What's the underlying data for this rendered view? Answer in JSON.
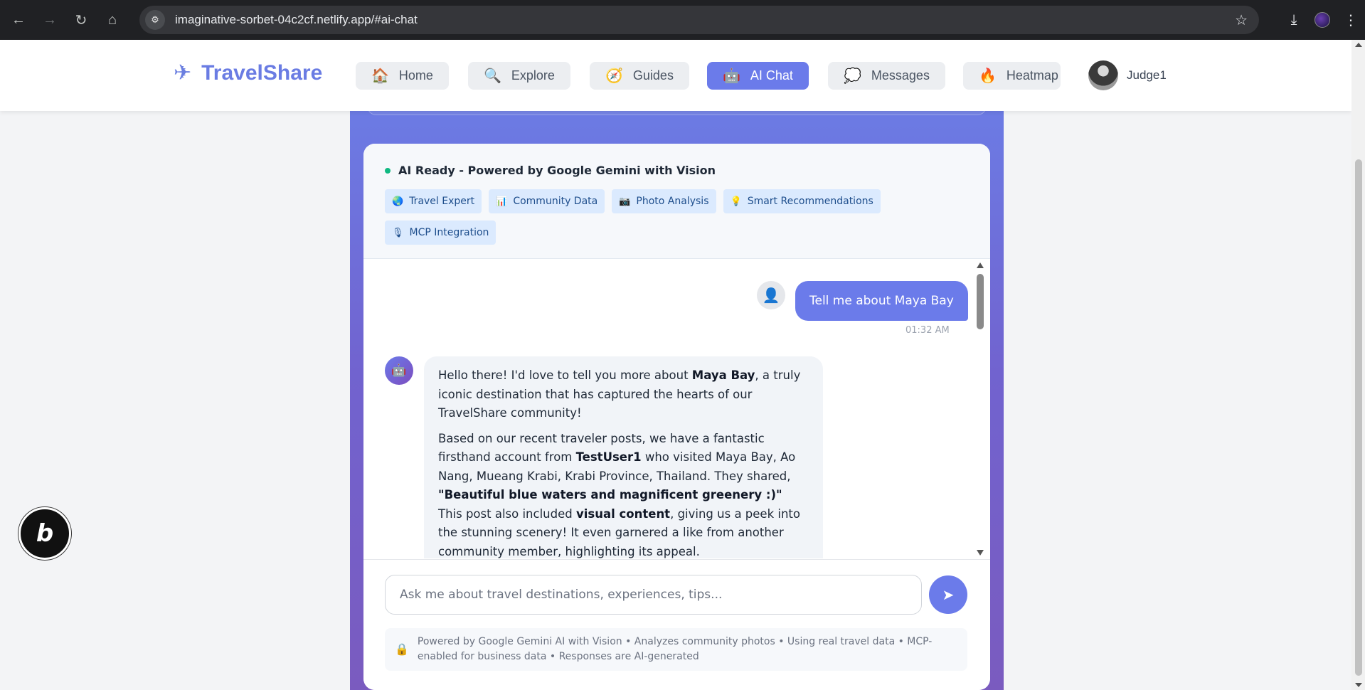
{
  "browser": {
    "url": "imaginative-sorbet-04c2cf.netlify.app/#ai-chat"
  },
  "header": {
    "brand": "TravelShare",
    "tabs": [
      {
        "label": "Home",
        "icon": "house-icon",
        "glyph": "🏠"
      },
      {
        "label": "Explore",
        "icon": "magnifier-icon",
        "glyph": "🔍"
      },
      {
        "label": "Guides",
        "icon": "compass-icon",
        "glyph": "🧭"
      },
      {
        "label": "AI Chat",
        "icon": "robot-icon",
        "glyph": "🤖"
      },
      {
        "label": "Messages",
        "icon": "speech-bubble-icon",
        "glyph": "💭"
      },
      {
        "label": "Heatmap",
        "icon": "fire-icon",
        "glyph": "🔥"
      }
    ],
    "active_tab": "AI Chat",
    "user_name": "Judge1"
  },
  "chat": {
    "status": "AI Ready - Powered by Google Gemini with Vision",
    "status_color": "#10b981",
    "chips": [
      {
        "label": "Travel Expert",
        "glyph": "🌏"
      },
      {
        "label": "Community Data",
        "glyph": "📊"
      },
      {
        "label": "Photo Analysis",
        "glyph": "📷"
      },
      {
        "label": "Smart Recommendations",
        "glyph": "💡"
      },
      {
        "label": "MCP Integration",
        "glyph": "🎙"
      }
    ],
    "user_message": {
      "text": "Tell me about Maya Bay",
      "time": "01:32 AM"
    },
    "bot_message": {
      "p1_a": "Hello there! I'd love to tell you more about ",
      "p1_b": "Maya Bay",
      "p1_c": ", a truly iconic destination that has captured the hearts of our TravelShare community!",
      "p2_a": "Based on our recent traveler posts, we have a fantastic firsthand account from ",
      "p2_b": "TestUser1",
      "p2_c": " who visited Maya Bay, Ao Nang, Mueang Krabi, Krabi Province, Thailand. They shared, ",
      "p2_d": "\"Beautiful blue waters and magnificent greenery :)\"",
      "p2_e": " This post also included ",
      "p2_f": "visual content",
      "p2_g": ", giving us a peek into the stunning scenery! It even garnered a like from another community member, highlighting its appeal."
    },
    "input_placeholder": "Ask me about travel destinations, experiences, tips...",
    "footnote": "Powered by Google Gemini AI with Vision • Analyzes community photos • Using real travel data • MCP-enabled for business data • Responses are AI-generated"
  },
  "colors": {
    "accent": "#6b7bea",
    "gradient_top": "#6c7be4",
    "gradient_bottom": "#7a5bbf"
  }
}
